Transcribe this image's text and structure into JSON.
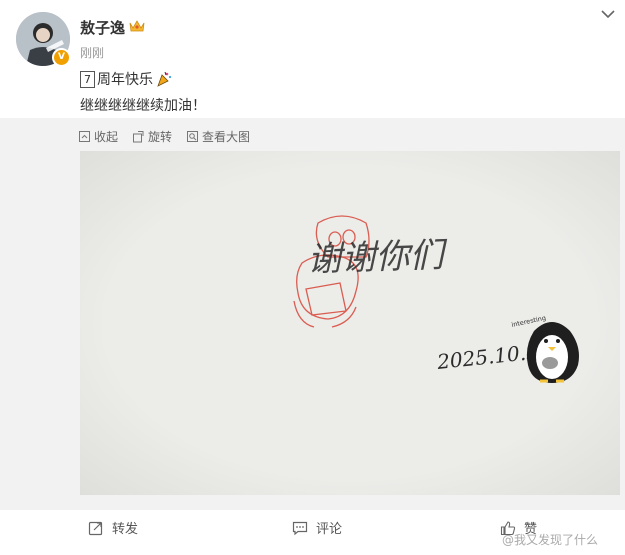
{
  "post": {
    "username": "敖子逸",
    "time": "刚刚",
    "boxed_number": "7",
    "line1_text": "周年快乐",
    "line2_text": "继继继继继续加油！"
  },
  "toolbar": {
    "collapse_label": "收起",
    "rotate_label": "旋转",
    "view_large_label": "查看大图"
  },
  "photo": {
    "handwritten_text": "谢谢你们",
    "date_text": "2025.10.31.",
    "sticker_text": "interesting"
  },
  "footer": {
    "repost_label": "转发",
    "comment_label": "评论",
    "like_label": "赞"
  },
  "watermark": "@我又发现了什么",
  "colors": {
    "badge": "#f0a000",
    "stamp_red": "#d63a2c",
    "photo_bg": "#e9e9e7",
    "panel_bg": "#f2f2f2"
  }
}
